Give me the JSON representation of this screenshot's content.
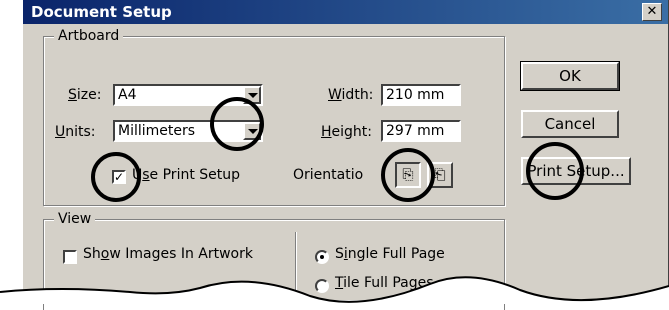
{
  "window": {
    "title": "Document Setup",
    "close_glyph": "✕"
  },
  "artboard": {
    "legend": "Artboard",
    "size_label": "Size:",
    "size_accel": "S",
    "size_rest": "ize:",
    "size_value": "A4",
    "units_label": "Units:",
    "units_accel": "U",
    "units_rest": "nits:",
    "units_value": "Millimeters",
    "width_accel": "W",
    "width_rest": "idth:",
    "width_value": "210 mm",
    "height_accel": "H",
    "height_rest": "eight:",
    "height_value": "297 mm",
    "use_print_pre": "U",
    "use_print_accel": "s",
    "use_print_rest": "e Print Setup",
    "use_print_checked": true,
    "orientation_label": "Orientation:",
    "orientation_visible": "Orientatio",
    "orientation_selected": "portrait"
  },
  "buttons": {
    "ok": "OK",
    "cancel": "Cancel",
    "print_setup": "Print Setup..."
  },
  "view": {
    "legend": "View",
    "show_images_pre": "Sh",
    "show_images_accel": "o",
    "show_images_rest": "w Images In Artwork",
    "show_images_checked": false,
    "single_full_page_pre": "S",
    "single_full_page_accel": "i",
    "single_full_page_rest": "ngle Full Page",
    "single_full_page_selected": true,
    "tile_full_pages_pre": "",
    "tile_full_pages_accel": "T",
    "tile_full_pages_rest": "ile Full Pages",
    "tile_full_pages_selected": false
  },
  "icons": [
    "close-icon",
    "dropdown-arrow-icon",
    "checkmark-icon",
    "portrait-orientation-icon",
    "landscape-orientation-icon"
  ],
  "colors": {
    "title_bar": "#0a246a",
    "dialog_face": "#d4d0c8",
    "highlight_circle": "#000000"
  }
}
